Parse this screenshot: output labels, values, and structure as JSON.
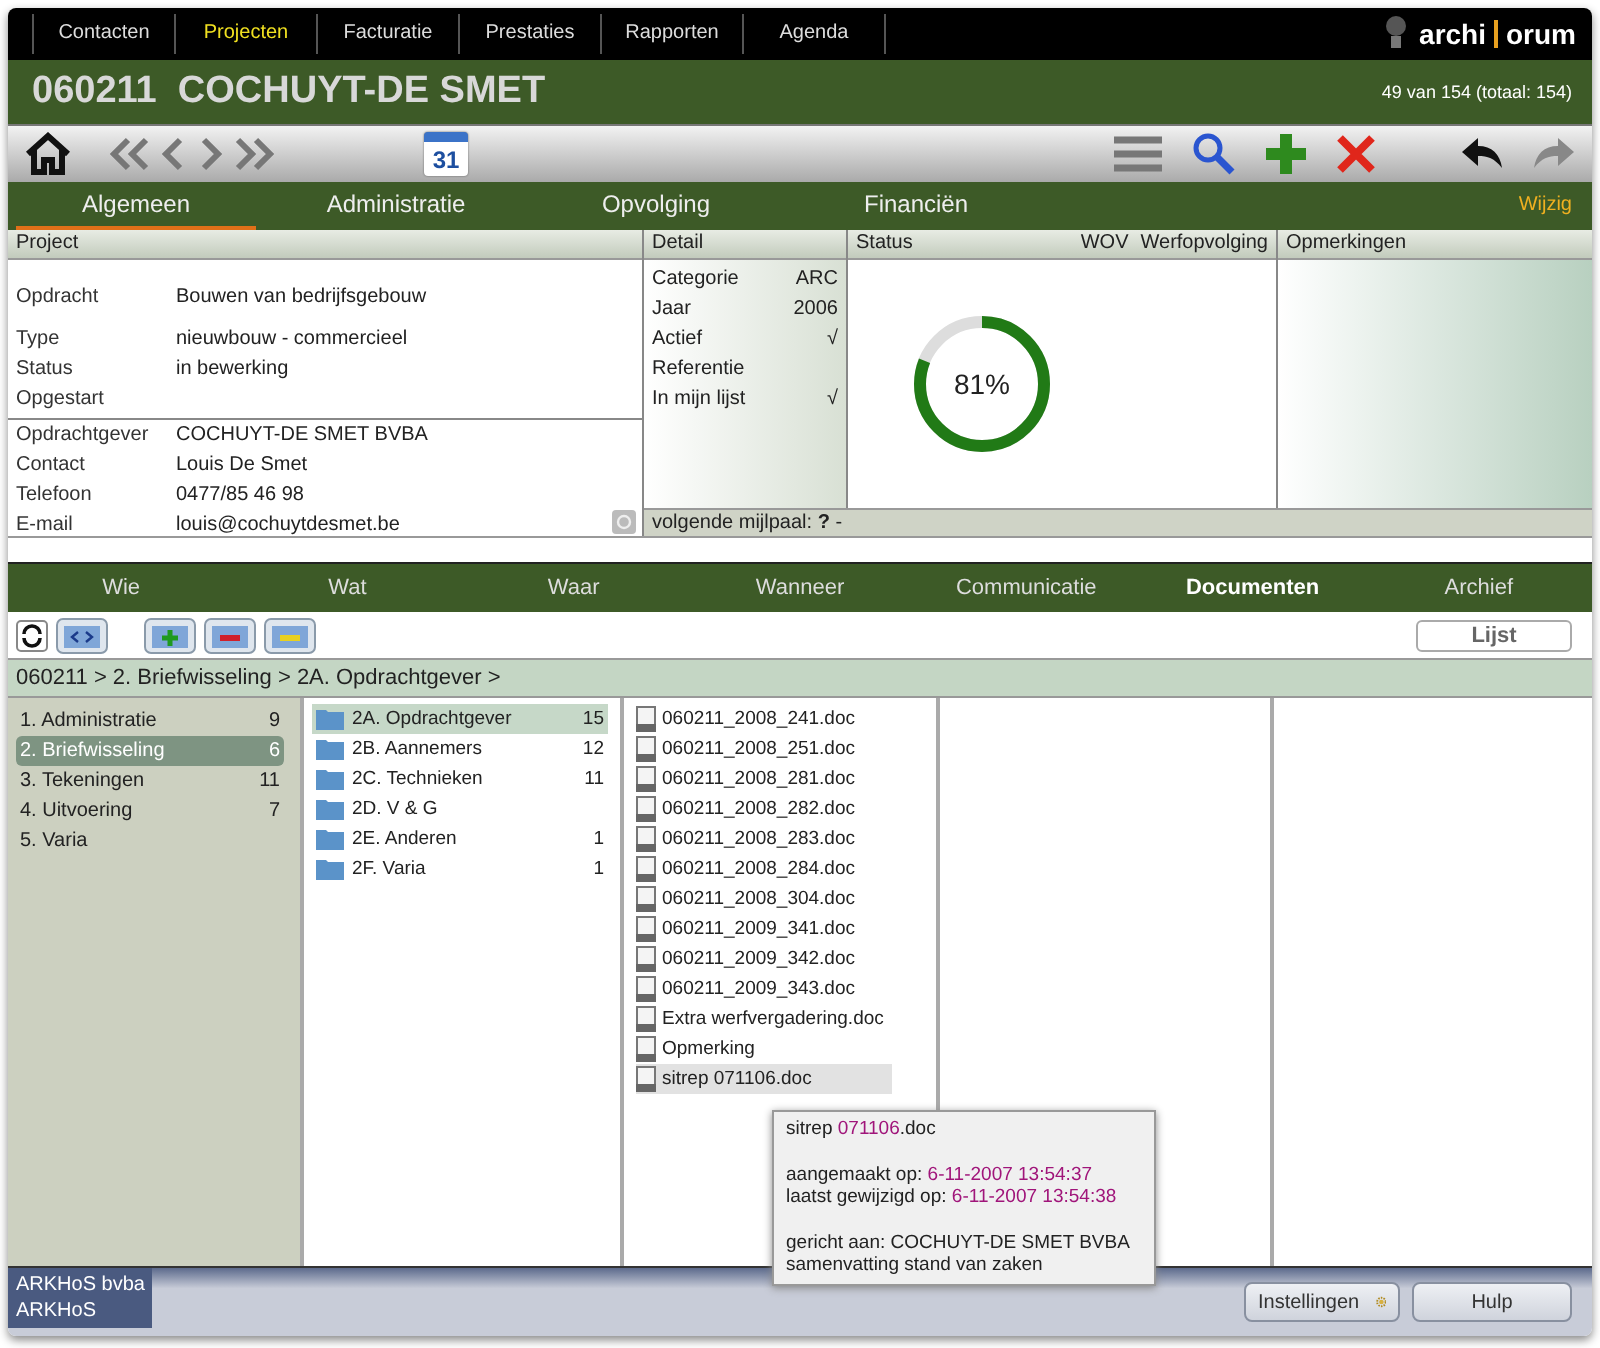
{
  "top_nav": [
    {
      "label": "Contacten",
      "selected": false
    },
    {
      "label": "Projecten",
      "selected": true
    },
    {
      "label": "Facturatie",
      "selected": false
    },
    {
      "label": "Prestaties",
      "selected": false
    },
    {
      "label": "Rapporten",
      "selected": false
    },
    {
      "label": "Agenda",
      "selected": false
    }
  ],
  "logo": {
    "left": "archi",
    "right": "orum"
  },
  "title": "060211  COCHUYT-DE SMET",
  "record_count": "49 van 154 (totaal: 154)",
  "calendar_day": "31",
  "tabs": [
    {
      "label": "Algemeen",
      "selected": true
    },
    {
      "label": "Administratie",
      "selected": false
    },
    {
      "label": "Opvolging",
      "selected": false
    },
    {
      "label": "Financiën",
      "selected": false
    }
  ],
  "edit_link": "Wijzig",
  "project": {
    "heading": "Project",
    "rows": [
      {
        "label": "Opdracht",
        "value": "Bouwen van bedrijfsgebouw"
      },
      {
        "label": "Type",
        "value": "nieuwbouw - commercieel"
      },
      {
        "label": "Status",
        "value": "in bewerking"
      },
      {
        "label": "Opgestart"
      }
    ],
    "contact_rows": [
      {
        "label": "Opdrachtgever",
        "value": "COCHUYT-DE SMET BVBA"
      },
      {
        "label": "Contact",
        "value": "Louis De Smet"
      },
      {
        "label": "Telefoon",
        "value": "0477/85 46 98"
      },
      {
        "label": "E-mail",
        "value": "louis@cochuytdesmet.be"
      }
    ]
  },
  "detail": {
    "heading": "Detail",
    "rows": [
      {
        "label": "Categorie",
        "value": "ARC"
      },
      {
        "label": "Jaar",
        "value": "2006"
      },
      {
        "label": "Actief",
        "value": "√"
      },
      {
        "label": "Referentie"
      },
      {
        "label": "In mijn lijst",
        "value": "√"
      }
    ]
  },
  "status": {
    "heading": "Status",
    "code": "WOV",
    "phase": "Werfopvolging",
    "level": 0.81,
    "reading": "81%"
  },
  "remarks": {
    "heading": "Opmerkingen"
  },
  "milestone": "volgende mijlpaal: **?**  -",
  "lower_tabs": [
    {
      "label": "Wie",
      "selected": false
    },
    {
      "label": "Wat",
      "selected": false
    },
    {
      "label": "Waar",
      "selected": false
    },
    {
      "label": "Wanneer",
      "selected": false
    },
    {
      "label": "Communicatie",
      "selected": false
    },
    {
      "label": "Documenten",
      "selected": true
    },
    {
      "label": "Archief",
      "selected": false
    }
  ],
  "list_button": "Lijst",
  "breadcrumb": "060211 > 2. Briefwisseling > 2A. Opdrachtgever >",
  "categories": [
    {
      "label": "1. Administratie",
      "count": "9",
      "selected": false
    },
    {
      "label": "2. Briefwisseling",
      "count": "6",
      "selected": true
    },
    {
      "label": "3. Tekeningen",
      "count": "11",
      "selected": false
    },
    {
      "label": "4. Uitvoering",
      "count": "7",
      "selected": false
    },
    {
      "label": "5. Varia",
      "selected": false
    }
  ],
  "folders": [
    {
      "label": "2A. Opdrachtgever",
      "count": "15",
      "selected": true
    },
    {
      "label": "2B. Aannemers",
      "count": "12",
      "selected": false
    },
    {
      "label": "2C. Technieken",
      "count": "11",
      "selected": false
    },
    {
      "label": "2D. V & G",
      "selected": false
    },
    {
      "label": "2E. Anderen",
      "count": "1",
      "selected": false
    },
    {
      "label": "2F. Varia",
      "count": "1",
      "selected": false
    }
  ],
  "files": [
    {
      "label": "060211_2008_241.doc",
      "selected": false
    },
    {
      "label": "060211_2008_251.doc",
      "selected": false
    },
    {
      "label": "060211_2008_281.doc",
      "selected": false
    },
    {
      "label": "060211_2008_282.doc",
      "selected": false
    },
    {
      "label": "060211_2008_283.doc",
      "selected": false
    },
    {
      "label": "060211_2008_284.doc",
      "selected": false
    },
    {
      "label": "060211_2008_304.doc",
      "selected": false
    },
    {
      "label": "060211_2009_341.doc",
      "selected": false
    },
    {
      "label": "060211_2009_342.doc",
      "selected": false
    },
    {
      "label": "060211_2009_343.doc",
      "selected": false
    },
    {
      "label": "Extra werfvergadering.doc",
      "selected": false
    },
    {
      "label": "Opmerking",
      "selected": false
    },
    {
      "label": "sitrep 071106.doc",
      "selected": true
    }
  ],
  "tooltip": {
    "paragraphs": [
      [
        [
          {
            "text": "sitrep ",
            "accent": false
          },
          {
            "text": "071106",
            "accent": true
          },
          {
            "text": ".doc",
            "accent": false
          }
        ]
      ],
      [
        [
          {
            "text": "aangemaakt op: ",
            "accent": false
          },
          {
            "text": "6-11-2007 13:54:37",
            "accent": true
          }
        ],
        [
          {
            "text": "laatst gewijzigd op: ",
            "accent": false
          },
          {
            "text": "6-11-2007 13:54:38",
            "accent": true
          }
        ]
      ],
      [
        [
          {
            "text": "gericht aan: COCHUYT-DE SMET BVBA",
            "accent": false
          }
        ],
        [
          {
            "text": "samenvatting stand van zaken",
            "accent": false
          }
        ]
      ]
    ]
  },
  "footer": {
    "company": "ARKHoS bvba",
    "user": "ARKHoS",
    "settings_button": "Instellingen",
    "help_button": "Hulp"
  }
}
